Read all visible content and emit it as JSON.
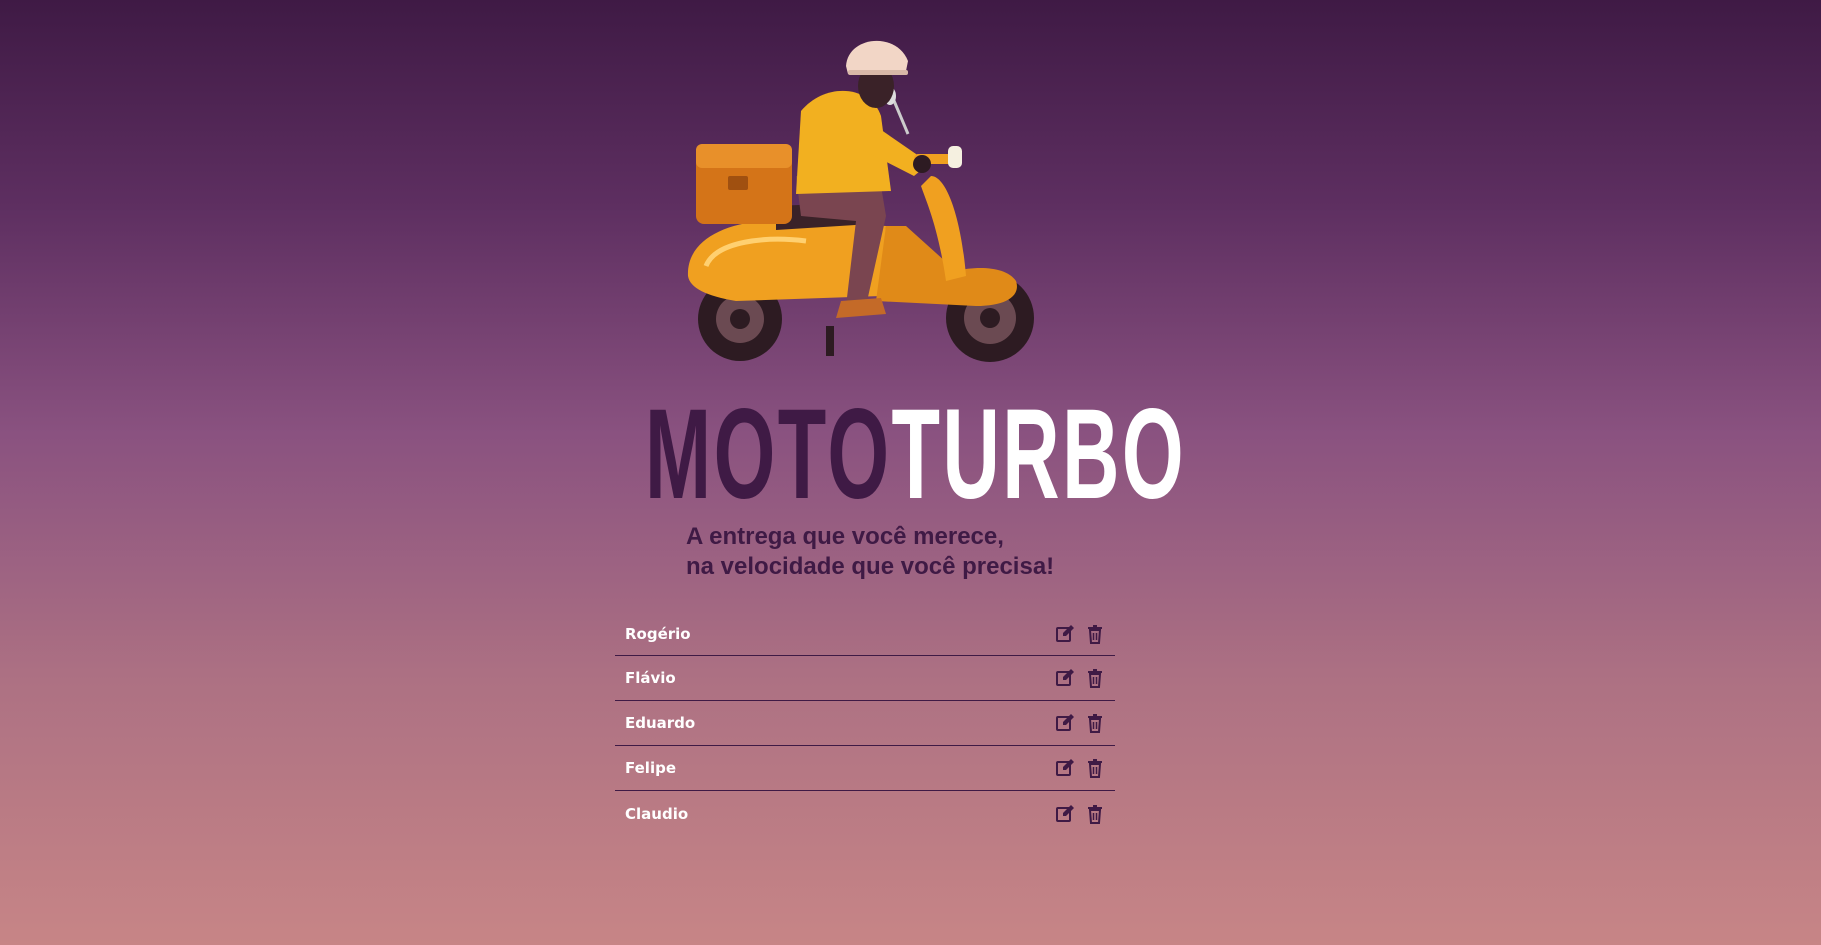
{
  "brand": {
    "part1": "MOTO",
    "part2": "TURBO"
  },
  "tagline": {
    "line1": "A entrega que você merece,",
    "line2": "na velocidade que você precisa!"
  },
  "couriers": [
    {
      "name": "Rogério"
    },
    {
      "name": "Flávio"
    },
    {
      "name": "Eduardo"
    },
    {
      "name": "Felipe"
    },
    {
      "name": "Claudio"
    }
  ],
  "icons": {
    "edit": "edit-icon",
    "delete": "trash-icon"
  },
  "colors": {
    "primary": "#3f1a45",
    "accent": "#f0a020",
    "text_light": "#ffffff"
  }
}
